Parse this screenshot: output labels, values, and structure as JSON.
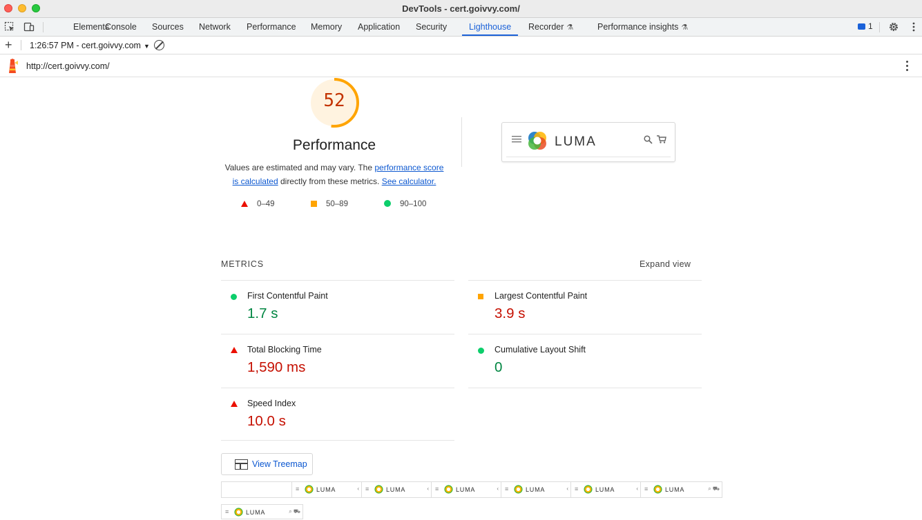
{
  "window": {
    "title": "DevTools - cert.goivvy.com/"
  },
  "tabs": [
    {
      "label": "Elements"
    },
    {
      "label": "Console"
    },
    {
      "label": "Sources"
    },
    {
      "label": "Network"
    },
    {
      "label": "Performance"
    },
    {
      "label": "Memory"
    },
    {
      "label": "Application"
    },
    {
      "label": "Security"
    },
    {
      "label": "Lighthouse",
      "active": true
    },
    {
      "label": "Recorder",
      "experimental": true
    },
    {
      "label": "Performance insights",
      "experimental": true
    }
  ],
  "issues_count": "1",
  "toolbar": {
    "report_label": "1:26:57 PM - cert.goivvy.com"
  },
  "url": "http://cert.goivvy.com/",
  "score": {
    "value": "52",
    "fraction": 0.52,
    "color": "#ffa400",
    "title": "Performance",
    "desc_prefix": "Values are estimated and may vary. The ",
    "desc_link1": "performance score is calculated",
    "desc_middle": " directly from these metrics. ",
    "desc_link2": "See calculator."
  },
  "legend": [
    {
      "range": "0–49",
      "shape": "triangle",
      "color": "#eb0f00"
    },
    {
      "range": "50–89",
      "shape": "square",
      "color": "#ffa400"
    },
    {
      "range": "90–100",
      "shape": "circle",
      "color": "#0cce6b"
    }
  ],
  "preview": {
    "brand": "LUMA"
  },
  "metrics": {
    "heading": "METRICS",
    "expand_label": "Expand view",
    "items": [
      {
        "label": "First Contentful Paint",
        "value": "1.7 s",
        "status": "pass"
      },
      {
        "label": "Largest Contentful Paint",
        "value": "3.9 s",
        "status": "average"
      },
      {
        "label": "Total Blocking Time",
        "value": "1,590 ms",
        "status": "fail"
      },
      {
        "label": "Cumulative Layout Shift",
        "value": "0",
        "status": "pass"
      },
      {
        "label": "Speed Index",
        "value": "10.0 s",
        "status": "fail"
      }
    ]
  },
  "treemap": {
    "label": "View Treemap"
  },
  "filmstrip": {
    "brand": "LUMA"
  },
  "colors": {
    "accent": "#1a61d8",
    "fail": "#c50f00",
    "pass": "#018642",
    "average": "#ffa400"
  }
}
